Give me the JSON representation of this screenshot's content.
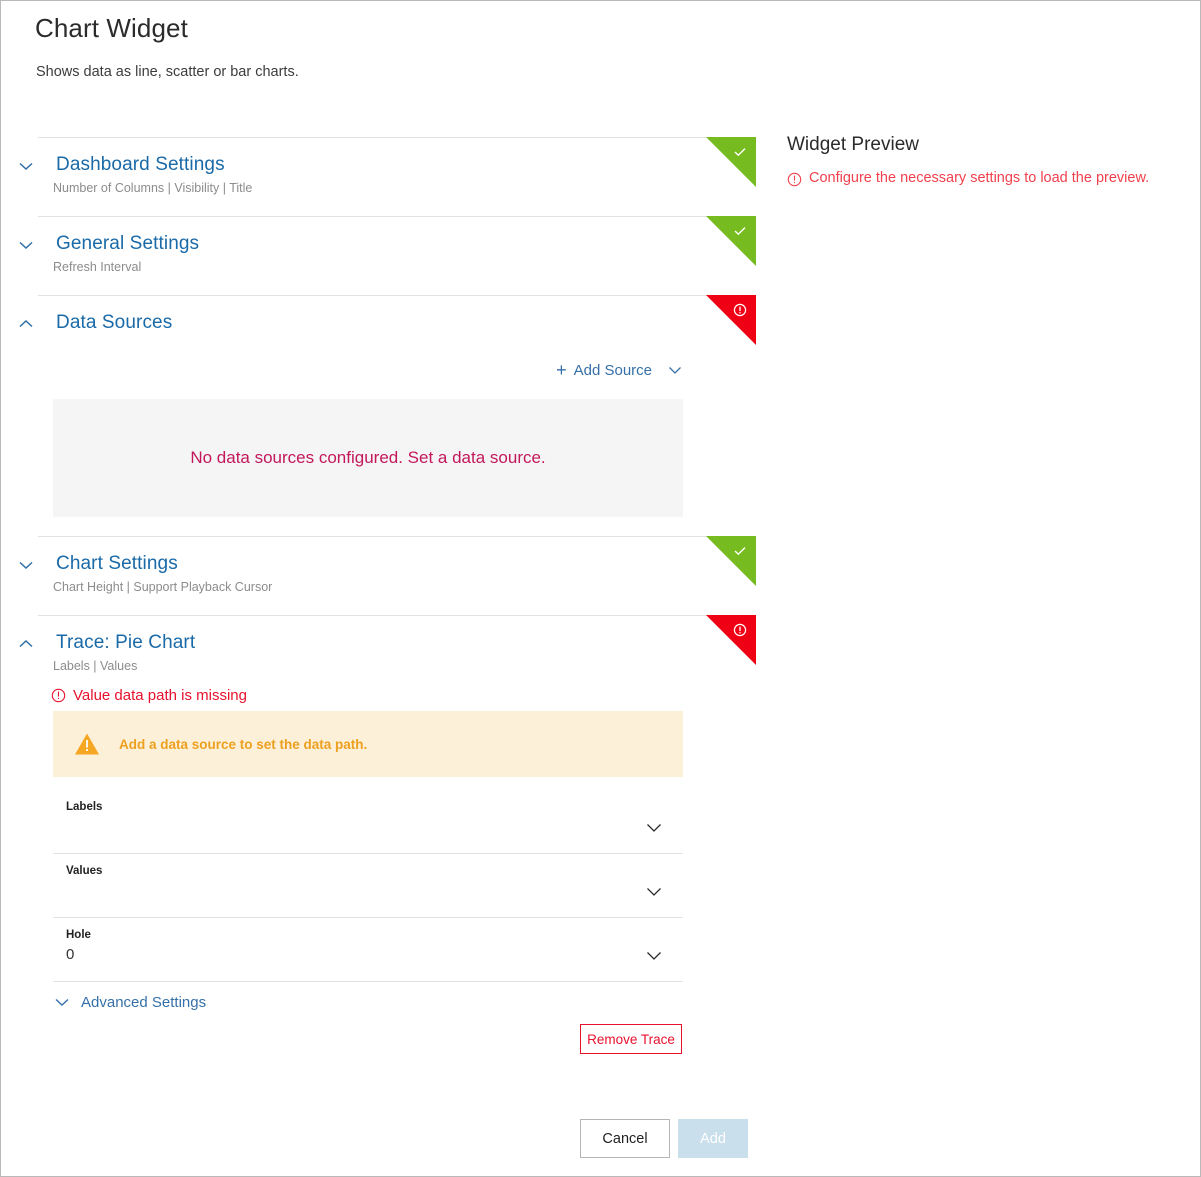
{
  "header": {
    "title": "Chart Widget",
    "subtitle": "Shows data as line, scatter or bar charts."
  },
  "sections": [
    {
      "title": "Dashboard Settings",
      "subtitle": "Number of Columns | Visibility | Title",
      "state": "valid",
      "expanded": false,
      "chevron_icon": "chevron-down-icon",
      "flag_icon": "check-icon"
    },
    {
      "title": "General Settings",
      "subtitle": "Refresh Interval",
      "state": "valid",
      "expanded": false,
      "chevron_icon": "chevron-down-icon",
      "flag_icon": "check-icon"
    },
    {
      "title": "Data Sources",
      "subtitle": "",
      "state": "error",
      "expanded": true,
      "chevron_icon": "chevron-up-icon",
      "flag_icon": "error-exclamation-icon"
    },
    {
      "title": "Chart Settings",
      "subtitle": "Chart Height | Support Playback Cursor",
      "state": "valid",
      "expanded": false,
      "chevron_icon": "chevron-down-icon",
      "flag_icon": "check-icon"
    },
    {
      "title": "Trace: Pie Chart",
      "subtitle": "Labels | Values",
      "state": "error",
      "expanded": true,
      "chevron_icon": "chevron-up-icon",
      "flag_icon": "error-exclamation-icon"
    }
  ],
  "data_sources": {
    "add_source_label": "Add Source",
    "add_source_plus": "+",
    "empty_message": "No data sources configured. Set a data source."
  },
  "trace": {
    "error_message": "Value data path is missing",
    "warning_message": "Add a data source to set the data path.",
    "fields": [
      {
        "label": "Labels",
        "value": ""
      },
      {
        "label": "Values",
        "value": ""
      },
      {
        "label": "Hole",
        "value": "0"
      }
    ],
    "advanced_settings_label": "Advanced Settings",
    "remove_trace_label": "Remove Trace"
  },
  "footer": {
    "cancel_label": "Cancel",
    "add_label": "Add"
  },
  "preview": {
    "title": "Widget Preview",
    "message": "Configure the necessary settings to load the preview."
  },
  "colors": {
    "link_blue": "#1a6aa8",
    "valid_green": "#76bc21",
    "error_red": "#f00014",
    "warning_orange": "#eda020",
    "warning_bg": "#fdf0d9",
    "empty_magenta": "#c2185b",
    "preview_error_red": "#f0404d",
    "add_disabled_bg": "#c9dfeb"
  }
}
